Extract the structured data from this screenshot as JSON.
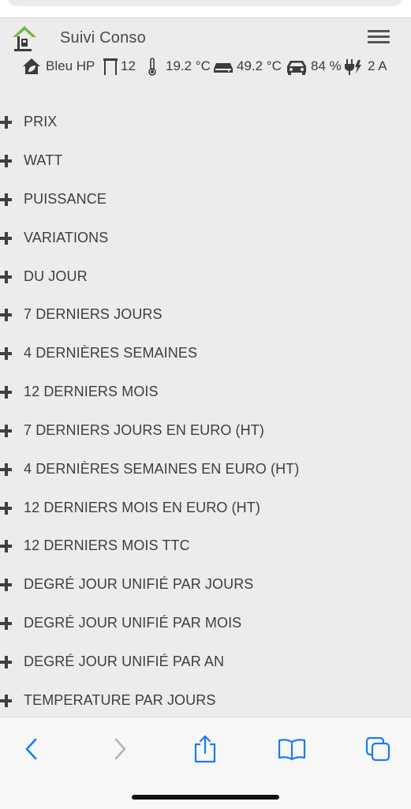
{
  "app": {
    "title": "Suivi Conso"
  },
  "status": {
    "tariff": "Bleu HP",
    "window_value": "12",
    "indoor_temp": "19.2 °C",
    "water_temp": "49.2 °C",
    "battery": "84 %",
    "current": "2 A"
  },
  "sections": [
    {
      "label": "PRIX"
    },
    {
      "label": "WATT"
    },
    {
      "label": "PUISSANCE"
    },
    {
      "label": "VARIATIONS"
    },
    {
      "label": "DU JOUR"
    },
    {
      "label": "7 DERNIERS JOURS"
    },
    {
      "label": "4 DERNIÈRES SEMAINES"
    },
    {
      "label": "12 DERNIERS MOIS"
    },
    {
      "label": "7 DERNIERS JOURS EN EURO (HT)"
    },
    {
      "label": "4 DERNIÈRES SEMAINES EN EURO (HT)"
    },
    {
      "label": "12 DERNIERS MOIS EN EURO (HT)"
    },
    {
      "label": "12 DERNIERS MOIS TTC"
    },
    {
      "label": "DEGRÉ JOUR UNIFIÉ PAR JOURS"
    },
    {
      "label": "DEGRÉ JOUR UNIFIÉ PAR MOIS"
    },
    {
      "label": "DEGRÉ JOUR UNIFIÉ PAR AN"
    },
    {
      "label": "TEMPERATURE PAR JOURS"
    }
  ],
  "toolbar": {
    "icons": [
      "back-chevron-icon",
      "forward-chevron-icon",
      "share-icon",
      "bookmarks-icon",
      "tabs-icon"
    ]
  },
  "colors": {
    "accent_blue": "#1a7cf3",
    "logo_green": "#7ab648",
    "background": "#ececec"
  }
}
